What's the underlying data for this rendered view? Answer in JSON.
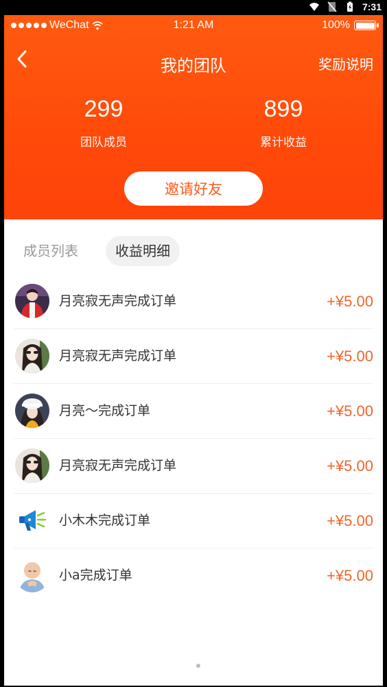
{
  "android_status": {
    "time": "7:31"
  },
  "ios_status": {
    "carrier": "WeChat",
    "time": "1:21 AM",
    "battery": "100%"
  },
  "nav": {
    "title": "我的团队",
    "right_link": "奖励说明"
  },
  "stats": [
    {
      "value": "299",
      "label": "团队成员"
    },
    {
      "value": "899",
      "label": "累计收益"
    }
  ],
  "invite_button": "邀请好友",
  "tabs": [
    {
      "label": "成员列表",
      "active": false
    },
    {
      "label": "收益明细",
      "active": true
    }
  ],
  "earnings": [
    {
      "text": "月亮寂无声完成订单",
      "amount": "+¥5.00",
      "avatar": "red-jacket-avatar"
    },
    {
      "text": "月亮寂无声完成订单",
      "amount": "+¥5.00",
      "avatar": "sunglasses-girl-avatar"
    },
    {
      "text": "月亮～完成订单",
      "amount": "+¥5.00",
      "avatar": "white-hat-girl-avatar"
    },
    {
      "text": "月亮寂无声完成订单",
      "amount": "+¥5.00",
      "avatar": "sunglasses-girl-avatar"
    },
    {
      "text": "小木木完成订单",
      "amount": "+¥5.00",
      "avatar": "megaphone-avatar"
    },
    {
      "text": "小a完成订单",
      "amount": "+¥5.00",
      "avatar": "cartoon-man-avatar"
    }
  ],
  "colors": {
    "header": "#ff4f0c",
    "accent": "#f0642a",
    "invite_text": "#ff5a1a"
  }
}
